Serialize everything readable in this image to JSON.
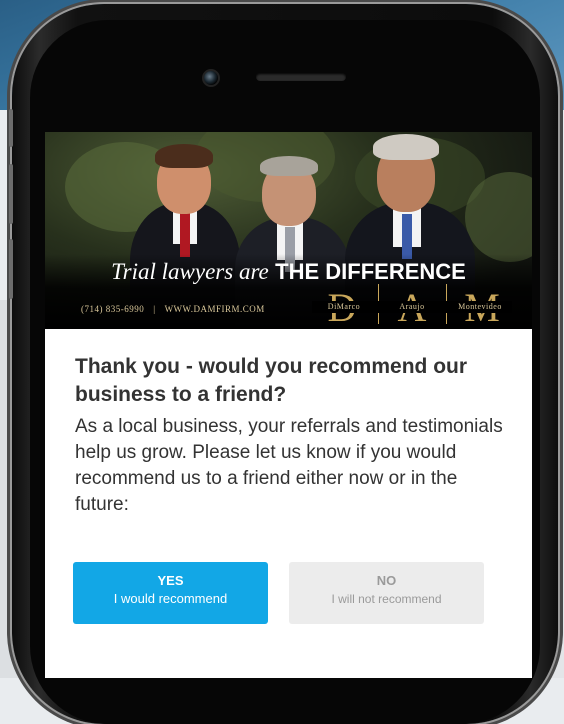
{
  "banner": {
    "tagline_italic": "Trial lawyers are",
    "tagline_bold": "THE DIFFERENCE",
    "phone": "(714) 835-6990",
    "separator": "|",
    "website": "WWW.DAMFIRM.COM",
    "logo": {
      "letters": [
        "D",
        "A",
        "M"
      ],
      "names": [
        "DiMarco",
        "Araujo",
        "Montevideo"
      ],
      "color": "#c9a75b"
    }
  },
  "survey": {
    "title": "Thank you - would you recommend our business to a friend?",
    "body": "As a local business, your referrals and testimonials help us grow. Please let us know if you would recommend us to a friend either now or in the future:",
    "yes_button": {
      "label": "YES",
      "sublabel": "I would recommend",
      "color": "#12a7e6"
    },
    "no_button": {
      "label": "NO",
      "sublabel": "I will not recommend",
      "color": "#ececec"
    }
  }
}
